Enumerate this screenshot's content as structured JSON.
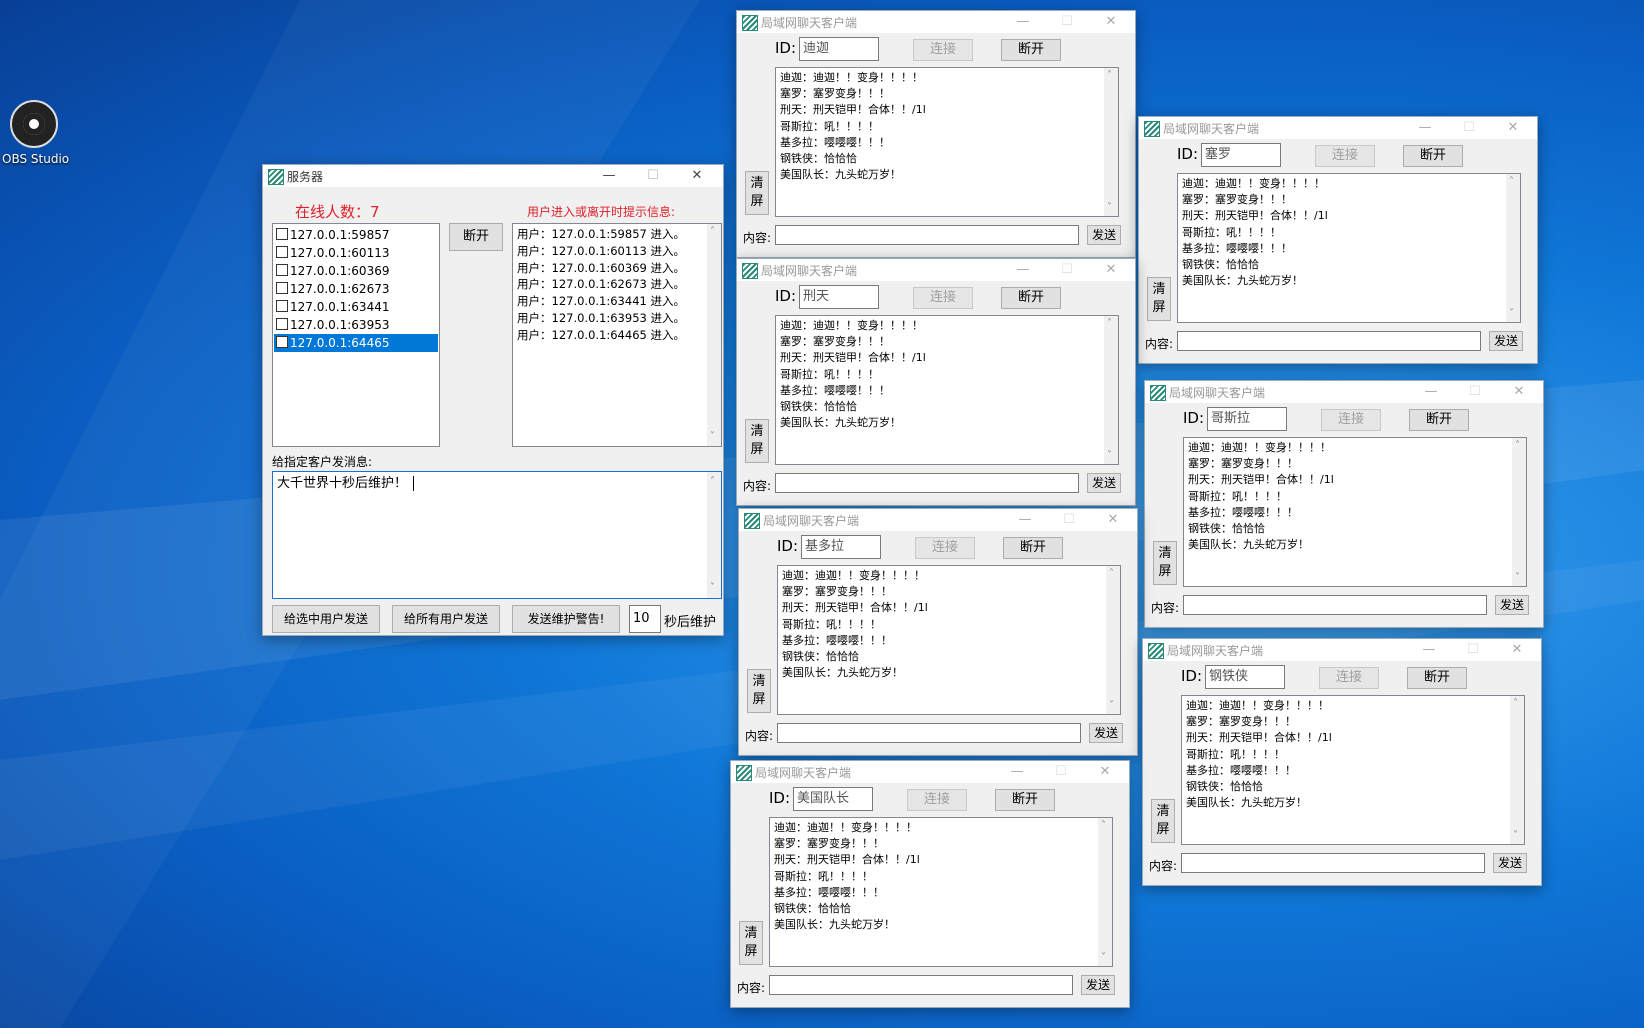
{
  "desktop": {
    "icon_label": "OBS Studio"
  },
  "server": {
    "title": "服务器",
    "online_count": "在线人数：7",
    "notice_header": "用户进入或离开时提示信息:",
    "disconnect": "断开",
    "clients": [
      {
        "addr": "127.0.0.1:59857",
        "selected": false
      },
      {
        "addr": "127.0.0.1:60113",
        "selected": false
      },
      {
        "addr": "127.0.0.1:60369",
        "selected": false
      },
      {
        "addr": "127.0.0.1:62673",
        "selected": false
      },
      {
        "addr": "127.0.0.1:63441",
        "selected": false
      },
      {
        "addr": "127.0.0.1:63953",
        "selected": false
      },
      {
        "addr": "127.0.0.1:64465",
        "selected": true
      }
    ],
    "notices": [
      "用户：127.0.0.1:59857 进入。",
      "用户：127.0.0.1:60113 进入。",
      "用户：127.0.0.1:60369 进入。",
      "用户：127.0.0.1:62673 进入。",
      "用户：127.0.0.1:63441 进入。",
      "用户：127.0.0.1:63953 进入。",
      "用户：127.0.0.1:64465 进入。"
    ],
    "send_label": "给指定客户发消息:",
    "message": "大千世界十秒后维护！",
    "btn_send_selected": "给选中用户发送",
    "btn_send_all": "给所有用户发送",
    "btn_maint": "发送维护警告!",
    "seconds": "10",
    "seconds_suffix": "秒后维护"
  },
  "client_common": {
    "title": "局域网聊天客户端",
    "id_label": "ID:",
    "connect": "连接",
    "disconnect": "断开",
    "clear": "清屏",
    "content_label": "内容:",
    "send": "发送",
    "messages": [
      "迪迦：迪迦！！变身！！！！",
      "塞罗：塞罗变身！！！",
      "刑天：刑天铠甲！合体！！/1l",
      "哥斯拉：吼！！！！",
      "基多拉：嘤嘤嘤！！！",
      "钢铁侠：恰恰恰",
      "美国队长：九头蛇万岁！"
    ]
  },
  "clients": [
    {
      "id": "迪迦"
    },
    {
      "id": "塞罗"
    },
    {
      "id": "刑天"
    },
    {
      "id": "哥斯拉"
    },
    {
      "id": "基多拉"
    },
    {
      "id": "钢铁侠"
    },
    {
      "id": "美国队长"
    }
  ]
}
